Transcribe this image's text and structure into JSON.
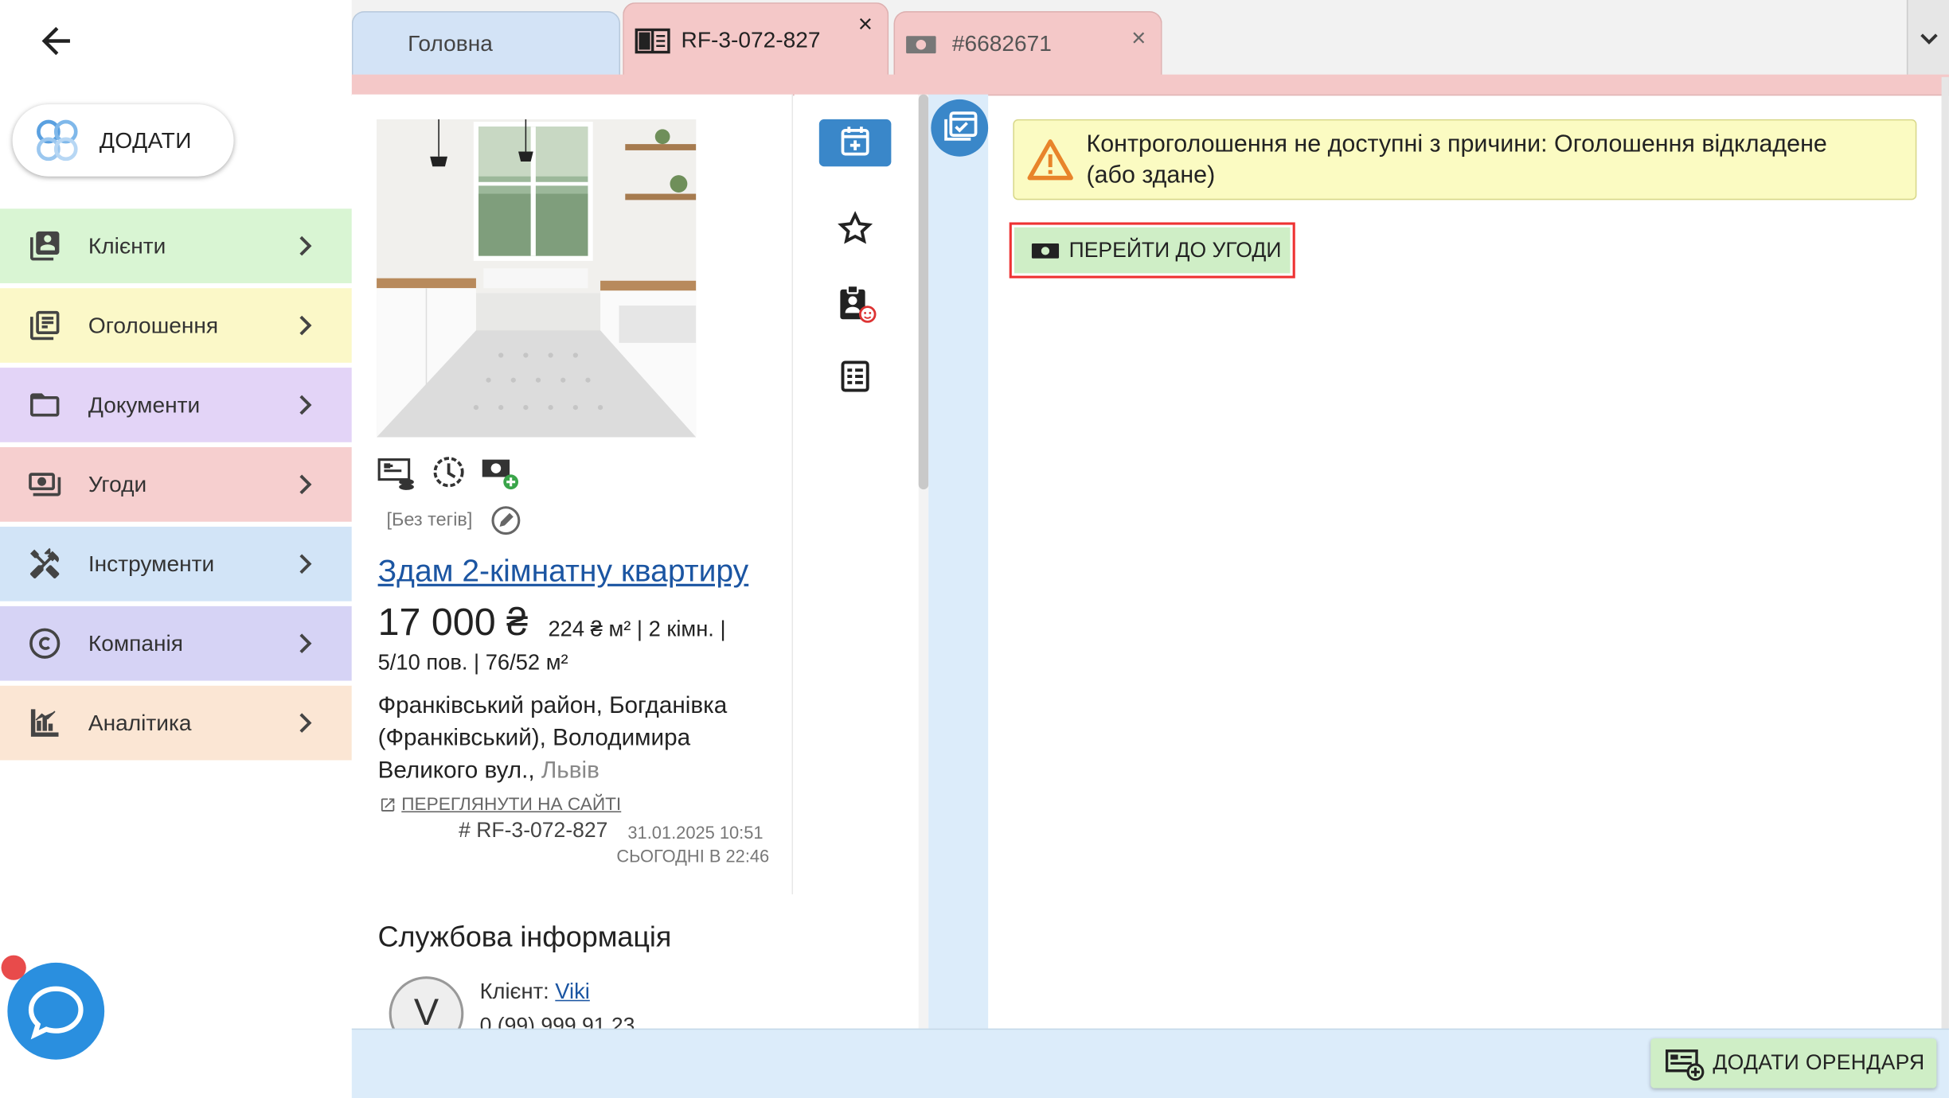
{
  "sidebar": {
    "add_label": "ДОДАТИ",
    "items": [
      {
        "label": "Клієнти",
        "color": "#d9f5d3",
        "icon": "clients-icon"
      },
      {
        "label": "Оголошення",
        "color": "#fbf8c8",
        "icon": "listings-icon"
      },
      {
        "label": "Документи",
        "color": "#e3d4f7",
        "icon": "folder-icon"
      },
      {
        "label": "Угоди",
        "color": "#f6cfcf",
        "icon": "deals-icon"
      },
      {
        "label": "Інструменти",
        "color": "#d2e4f7",
        "icon": "tools-icon"
      },
      {
        "label": "Компанія",
        "color": "#d6d3f5",
        "icon": "copyright-icon"
      },
      {
        "label": "Аналітика",
        "color": "#fbe6d4",
        "icon": "analytics-icon"
      }
    ]
  },
  "tabs": [
    {
      "label": "Головна"
    },
    {
      "label": "RF-3-072-827",
      "close": "×"
    },
    {
      "label": "#6682671",
      "close": "×"
    }
  ],
  "listing": {
    "tags": "[Без тегів]",
    "title": "Здам 2-кімнатну квартиру",
    "price": "17 000 ₴",
    "details_line1": "224 ₴ м² | 2 кімн. |",
    "details_line2": "5/10 пов. | 76/52 м²",
    "address": "Франківський район, Богданівка (Франківський), Володимира Великого вул.,",
    "city": "Львів",
    "view_on_site": "ПЕРЕГЛЯНУТИ НА САЙТІ",
    "ref": "# RF-3-072-827",
    "created": "31.01.2025 10:51",
    "updated": "СЬОГОДНІ В 22:46"
  },
  "service": {
    "title": "Службова інформація",
    "avatar_letter": "V",
    "client_label": "Клієнт:",
    "client_name": "Viki",
    "phone_partial": "0 (99) 999 91 23"
  },
  "main": {
    "warning": "Контроголошення не доступні з причини: Оголошення відкладене (або здане)",
    "goto_deal": "ПЕРЕЙТИ ДО УГОДИ"
  },
  "bottom": {
    "add_tenant": "ДОДАТИ ОРЕНДАРЯ"
  }
}
